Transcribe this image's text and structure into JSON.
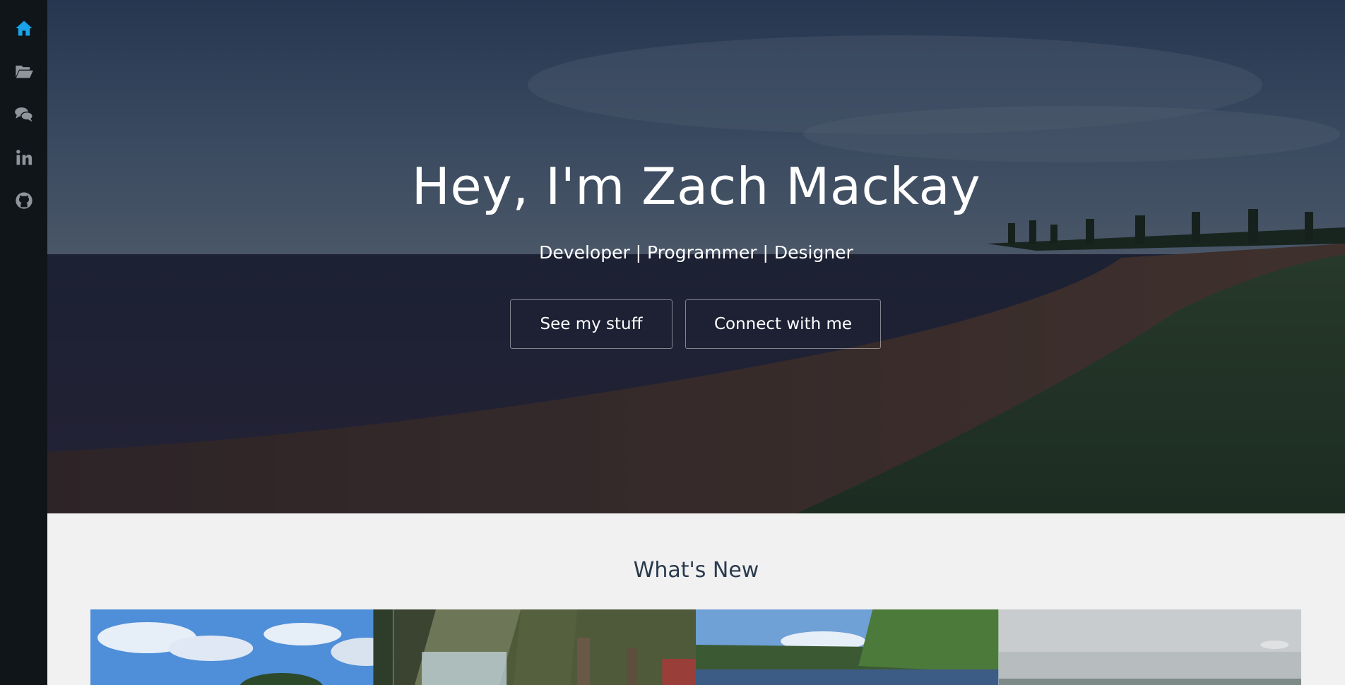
{
  "sidebar": {
    "items": [
      {
        "name": "home",
        "icon": "home-icon",
        "color": "#1aa3e8",
        "active": true
      },
      {
        "name": "projects",
        "icon": "folder-open-icon",
        "color": "#8e959b"
      },
      {
        "name": "contact",
        "icon": "chat-bubbles-icon",
        "color": "#8e959b"
      },
      {
        "name": "linkedin",
        "icon": "linkedin-icon",
        "color": "#8e959b"
      },
      {
        "name": "github",
        "icon": "github-icon",
        "color": "#8e959b"
      }
    ]
  },
  "hero": {
    "title": "Hey, I'm Zach Mackay",
    "subtitle": "Developer | Programmer | Designer",
    "buttons": {
      "see_stuff": "See my stuff",
      "connect": "Connect with me"
    }
  },
  "whats_new": {
    "title": "What's New",
    "items": [
      {
        "name": "gallery-item-1"
      },
      {
        "name": "gallery-item-2"
      },
      {
        "name": "gallery-item-3"
      },
      {
        "name": "gallery-item-4"
      }
    ]
  },
  "colors": {
    "sidebar_bg": "#0f1519",
    "accent": "#1aa3e8",
    "icon_muted": "#8e959b",
    "section_bg": "#f1f1f1",
    "section_title": "#2a3a4d"
  }
}
